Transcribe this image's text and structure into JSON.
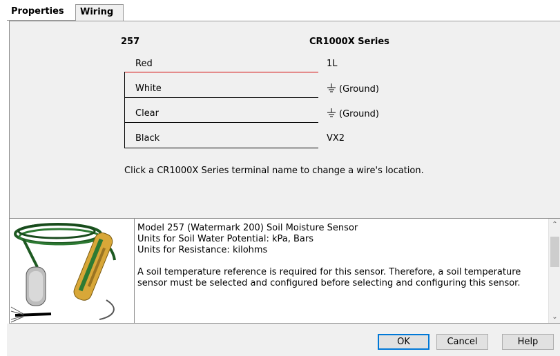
{
  "tabs": {
    "properties": "Properties",
    "wiring": "Wiring"
  },
  "wiring": {
    "sensor_header": "257",
    "logger_header": "CR1000X Series",
    "rows": [
      {
        "wire": "Red",
        "terminal": "1L"
      },
      {
        "wire": "White",
        "terminal": "(Ground)"
      },
      {
        "wire": "Clear",
        "terminal": "(Ground)"
      },
      {
        "wire": "Black",
        "terminal": "VX2"
      }
    ],
    "note": "Click a CR1000X Series terminal name to change a wire's location.",
    "colors": {
      "red_wire": "#d40000",
      "black_wire": "#000000"
    },
    "icons": {
      "ground": "ground-icon"
    }
  },
  "description": {
    "lines": [
      "Model 257 (Watermark 200) Soil Moisture Sensor",
      "Units for Soil Water Potential: kPa, Bars",
      "Units for Resistance: kilohms",
      "",
      "A soil temperature reference is required for this sensor. Therefore, a soil temperature sensor must be selected and configured before selecting and configuring this sensor."
    ]
  },
  "buttons": {
    "ok": "OK",
    "cancel": "Cancel",
    "help": "Help"
  }
}
